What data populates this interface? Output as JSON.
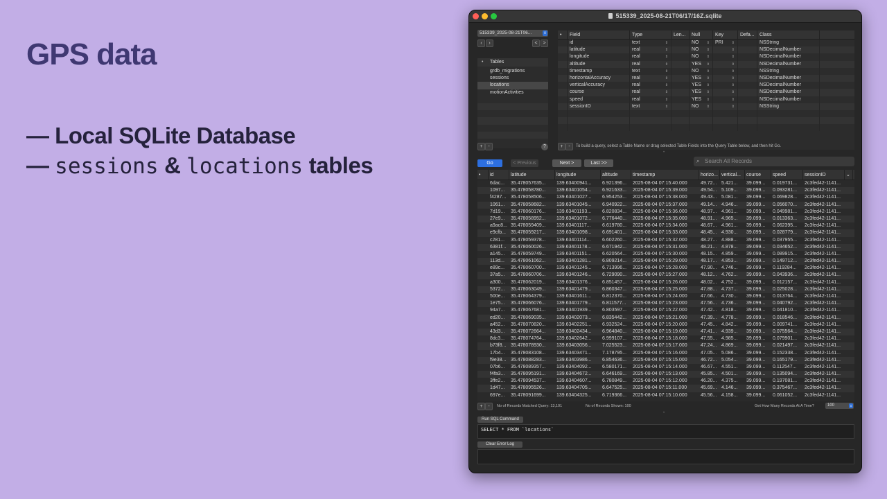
{
  "slide": {
    "title": "GPS data",
    "bullet1": "— Local SQLite Database",
    "bullet2_dash": "— ",
    "bullet2_code1": "sessions",
    "bullet2_amp": " & ",
    "bullet2_code2": "locations",
    "bullet2_tail": " tables"
  },
  "window": {
    "title": "515339_2025-08-21T06/17/16Z.sqlite"
  },
  "sidebar": {
    "database": "515339_2025-08-21T06...",
    "tables_header": "Tables",
    "tables": [
      "grdb_migrations",
      "sessions",
      "locations",
      "motionActivities"
    ],
    "selected": "locations"
  },
  "schema": {
    "headers": [
      "Field",
      "Type",
      "Len...",
      "Null",
      "Key",
      "Defa...",
      "Class"
    ],
    "rows": [
      [
        "id",
        "text",
        "",
        "NO",
        "PRI",
        "",
        "NSString"
      ],
      [
        "latitude",
        "real",
        "",
        "NO",
        "",
        "",
        "NSDecimalNumber"
      ],
      [
        "longitude",
        "real",
        "",
        "NO",
        "",
        "",
        "NSDecimalNumber"
      ],
      [
        "altitude",
        "real",
        "",
        "YES",
        "",
        "",
        "NSDecimalNumber"
      ],
      [
        "timestamp",
        "text",
        "",
        "NO",
        "",
        "",
        "NSString"
      ],
      [
        "horizontalAccuracy",
        "real",
        "",
        "YES",
        "",
        "",
        "NSDecimalNumber"
      ],
      [
        "verticalAccuracy",
        "real",
        "",
        "YES",
        "",
        "",
        "NSDecimalNumber"
      ],
      [
        "course",
        "real",
        "",
        "YES",
        "",
        "",
        "NSDecimalNumber"
      ],
      [
        "speed",
        "real",
        "",
        "YES",
        "",
        "",
        "NSDecimalNumber"
      ],
      [
        "sessionID",
        "text",
        "",
        "NO",
        "",
        "",
        "NSString"
      ]
    ],
    "hint": "To build a query, select a Table Name or drag selected Table Fields into the Query Table below, and then hit Go."
  },
  "toolbar": {
    "go": "Go",
    "previous": "< Previous",
    "next": "Next >",
    "last": "Last >>",
    "search_placeholder": "Search All Records"
  },
  "grid": {
    "headers": [
      "id",
      "latitude",
      "longitude",
      "altitude",
      "timestamp",
      "horizo...",
      "vertical...",
      "course",
      "speed",
      "sessionID"
    ],
    "rows": [
      [
        "6dac...",
        "35.478057635...",
        "139.63400941...",
        "6.921396...",
        "2025-08-04 07:15:40.000",
        "49.72...",
        "5.421...",
        "39.099...",
        "0.019731...",
        "2c3fed42-1141..."
      ],
      [
        "1097...",
        "35.478058780...",
        "139.63401054...",
        "6.921633...",
        "2025-08-04 07:15:39.000",
        "49.54...",
        "5.109...",
        "39.099...",
        "0.093281...",
        "2c3fed42-1141..."
      ],
      [
        "f4287...",
        "35.478058506...",
        "139.63401027...",
        "6.954253...",
        "2025-08-04 07:15:38.000",
        "49.43...",
        "5.081...",
        "39.099...",
        "0.069828...",
        "2c3fed42-1141..."
      ],
      [
        "1061...",
        "35.478058682...",
        "139.63401045...",
        "6.940922...",
        "2025-08-04 07:15:37.000",
        "49.14...",
        "4.946...",
        "39.099...",
        "0.056070...",
        "2c3fed42-1141..."
      ],
      [
        "7d19...",
        "35.478060176...",
        "139.63401193...",
        "6.820834...",
        "2025-08-04 07:15:36.000",
        "48.97...",
        "4.961...",
        "39.099...",
        "0.049981...",
        "2c3fed42-1141..."
      ],
      [
        "27e9...",
        "35.478058952...",
        "139.63401072...",
        "6.776440...",
        "2025-08-04 07:15:35.000",
        "48.91...",
        "4.965...",
        "39.099...",
        "0.013363...",
        "2c3fed42-1141..."
      ],
      [
        "a9ac8...",
        "35.478059409...",
        "139.63401117...",
        "6.619780...",
        "2025-08-04 07:15:34.000",
        "48.67...",
        "4.961...",
        "39.099...",
        "0.062395...",
        "2c3fed42-1141..."
      ],
      [
        "e9cfb...",
        "35.478059217...",
        "139.63401098...",
        "6.691401...",
        "2025-08-04 07:15:33.000",
        "48.45...",
        "4.930...",
        "39.099...",
        "0.028779...",
        "2c3fed42-1141..."
      ],
      [
        "c281...",
        "35.478059378...",
        "139.63401114...",
        "6.602260...",
        "2025-08-04 07:15:32.000",
        "48.27...",
        "4.888...",
        "39.099...",
        "0.037955...",
        "2c3fed42-1141..."
      ],
      [
        "6381f...",
        "35.478060026...",
        "139.63401178...",
        "6.671942...",
        "2025-08-04 07:15:31.000",
        "48.21...",
        "4.878...",
        "39.099...",
        "0.034652...",
        "2c3fed42-1141..."
      ],
      [
        "a145...",
        "35.478059749...",
        "139.63401151...",
        "6.620564...",
        "2025-08-04 07:15:30.000",
        "48.15...",
        "4.859...",
        "39.099...",
        "0.089915...",
        "2c3fed42-1141..."
      ],
      [
        "113d...",
        "35.478061062...",
        "139.63401281...",
        "6.809214...",
        "2025-08-04 07:15:29.000",
        "48.17...",
        "4.853...",
        "39.099...",
        "0.149712...",
        "2c3fed42-1141..."
      ],
      [
        "e89c...",
        "35.478060700...",
        "139.63401245...",
        "6.713996...",
        "2025-08-04 07:15:28.000",
        "47.90...",
        "4.746...",
        "39.099...",
        "0.119284...",
        "2c3fed42-1141..."
      ],
      [
        "37a5...",
        "35.478060706...",
        "139.63401246...",
        "6.729090...",
        "2025-08-04 07:15:27.000",
        "48.12...",
        "4.762...",
        "39.099...",
        "0.043936...",
        "2c3fed42-1141..."
      ],
      [
        "a300...",
        "35.478062019...",
        "139.63401376...",
        "6.851457...",
        "2025-08-04 07:15:26.000",
        "48.02...",
        "4.752...",
        "39.099...",
        "0.012157...",
        "2c3fed42-1141..."
      ],
      [
        "5372...",
        "35.478063049...",
        "139.63401479...",
        "6.860347...",
        "2025-08-04 07:15:25.000",
        "47.88...",
        "4.737...",
        "39.099...",
        "0.025028...",
        "2c3fed42-1141..."
      ],
      [
        "500e...",
        "35.478064379...",
        "139.63401611...",
        "6.812370...",
        "2025-08-04 07:15:24.000",
        "47.66...",
        "4.730...",
        "39.099...",
        "0.013764...",
        "2c3fed42-1141..."
      ],
      [
        "1e75...",
        "35.478066076...",
        "139.63401779...",
        "6.811577...",
        "2025-08-04 07:15:23.000",
        "47.56...",
        "4.736...",
        "39.099...",
        "0.040792...",
        "2c3fed42-1141..."
      ],
      [
        "94a7...",
        "35.478067681...",
        "139.63401939...",
        "6.803597...",
        "2025-08-04 07:15:22.000",
        "47.42...",
        "4.818...",
        "39.099...",
        "0.041810...",
        "2c3fed42-1141..."
      ],
      [
        "ed20...",
        "35.478069035...",
        "139.63402073...",
        "6.835442...",
        "2025-08-04 07:15:21.000",
        "47.39...",
        "4.778...",
        "39.099...",
        "0.018546...",
        "2c3fed42-1141..."
      ],
      [
        "a452...",
        "35.478070820...",
        "139.63402251...",
        "6.932524...",
        "2025-08-04 07:15:20.000",
        "47.45...",
        "4.842...",
        "39.099...",
        "0.009741...",
        "2c3fed42-1141..."
      ],
      [
        "43d3...",
        "35.478072664...",
        "139.63402434...",
        "6.964840...",
        "2025-08-04 07:15:19.000",
        "47.41...",
        "4.939...",
        "39.099...",
        "0.075564...",
        "2c3fed42-1141..."
      ],
      [
        "8dc3...",
        "35.478074764...",
        "139.63402642...",
        "6.999107...",
        "2025-08-04 07:15:18.000",
        "47.55...",
        "4.985...",
        "39.099...",
        "0.079901...",
        "2c3fed42-1141..."
      ],
      [
        "b73f8...",
        "35.478078930...",
        "139.63403056...",
        "7.025523...",
        "2025-08-04 07:15:17.000",
        "47.24...",
        "4.869...",
        "39.099...",
        "0.021497...",
        "2c3fed42-1141..."
      ],
      [
        "17b4...",
        "35.478083108...",
        "139.63403471...",
        "7.178795...",
        "2025-08-04 07:15:16.000",
        "47.05...",
        "5.086...",
        "39.099...",
        "0.152338...",
        "2c3fed42-1141..."
      ],
      [
        "f9e38...",
        "35.478088283...",
        "139.63403986...",
        "6.854636...",
        "2025-08-04 07:15:15.000",
        "46.72...",
        "5.054...",
        "39.099...",
        "0.165179...",
        "2c3fed42-1141..."
      ],
      [
        "07b6...",
        "35.478089357...",
        "139.63404092...",
        "6.580171...",
        "2025-08-04 07:15:14.000",
        "46.67...",
        "4.551...",
        "39.099...",
        "0.112547...",
        "2c3fed42-1141..."
      ],
      [
        "f4fa3...",
        "35.478095191...",
        "139.63404672...",
        "6.646169...",
        "2025-08-04 07:15:13.000",
        "45.85...",
        "4.501...",
        "39.099...",
        "0.135094...",
        "2c3fed42-1141..."
      ],
      [
        "3ffe2...",
        "35.478094537...",
        "139.63404607...",
        "6.780849...",
        "2025-08-04 07:15:12.000",
        "46.20...",
        "4.375...",
        "39.099...",
        "0.197081...",
        "2c3fed42-1141..."
      ],
      [
        "1d47...",
        "35.478095526...",
        "139.63404705...",
        "6.647525...",
        "2025-08-04 07:15:11.000",
        "45.69...",
        "4.146...",
        "39.099...",
        "0.375467...",
        "2c3fed42-1141..."
      ],
      [
        "697e...",
        "35.478091699...",
        "139.63404325...",
        "6.719366...",
        "2025-08-04 07:15:10.000",
        "45.56...",
        "4.158...",
        "39.099...",
        "0.061052...",
        "2c3fed42-1141..."
      ]
    ]
  },
  "status": {
    "matched": "No of Records Matched Query: 13,101",
    "shown": "No of Records Shown: 100",
    "per_page_label": "Get How Many Records At A Time?",
    "per_page_value": "100"
  },
  "sql": {
    "run_label": "Run SQL Command",
    "query": "SELECT * FROM `locations`",
    "clear_label": "Clear Error Log"
  }
}
